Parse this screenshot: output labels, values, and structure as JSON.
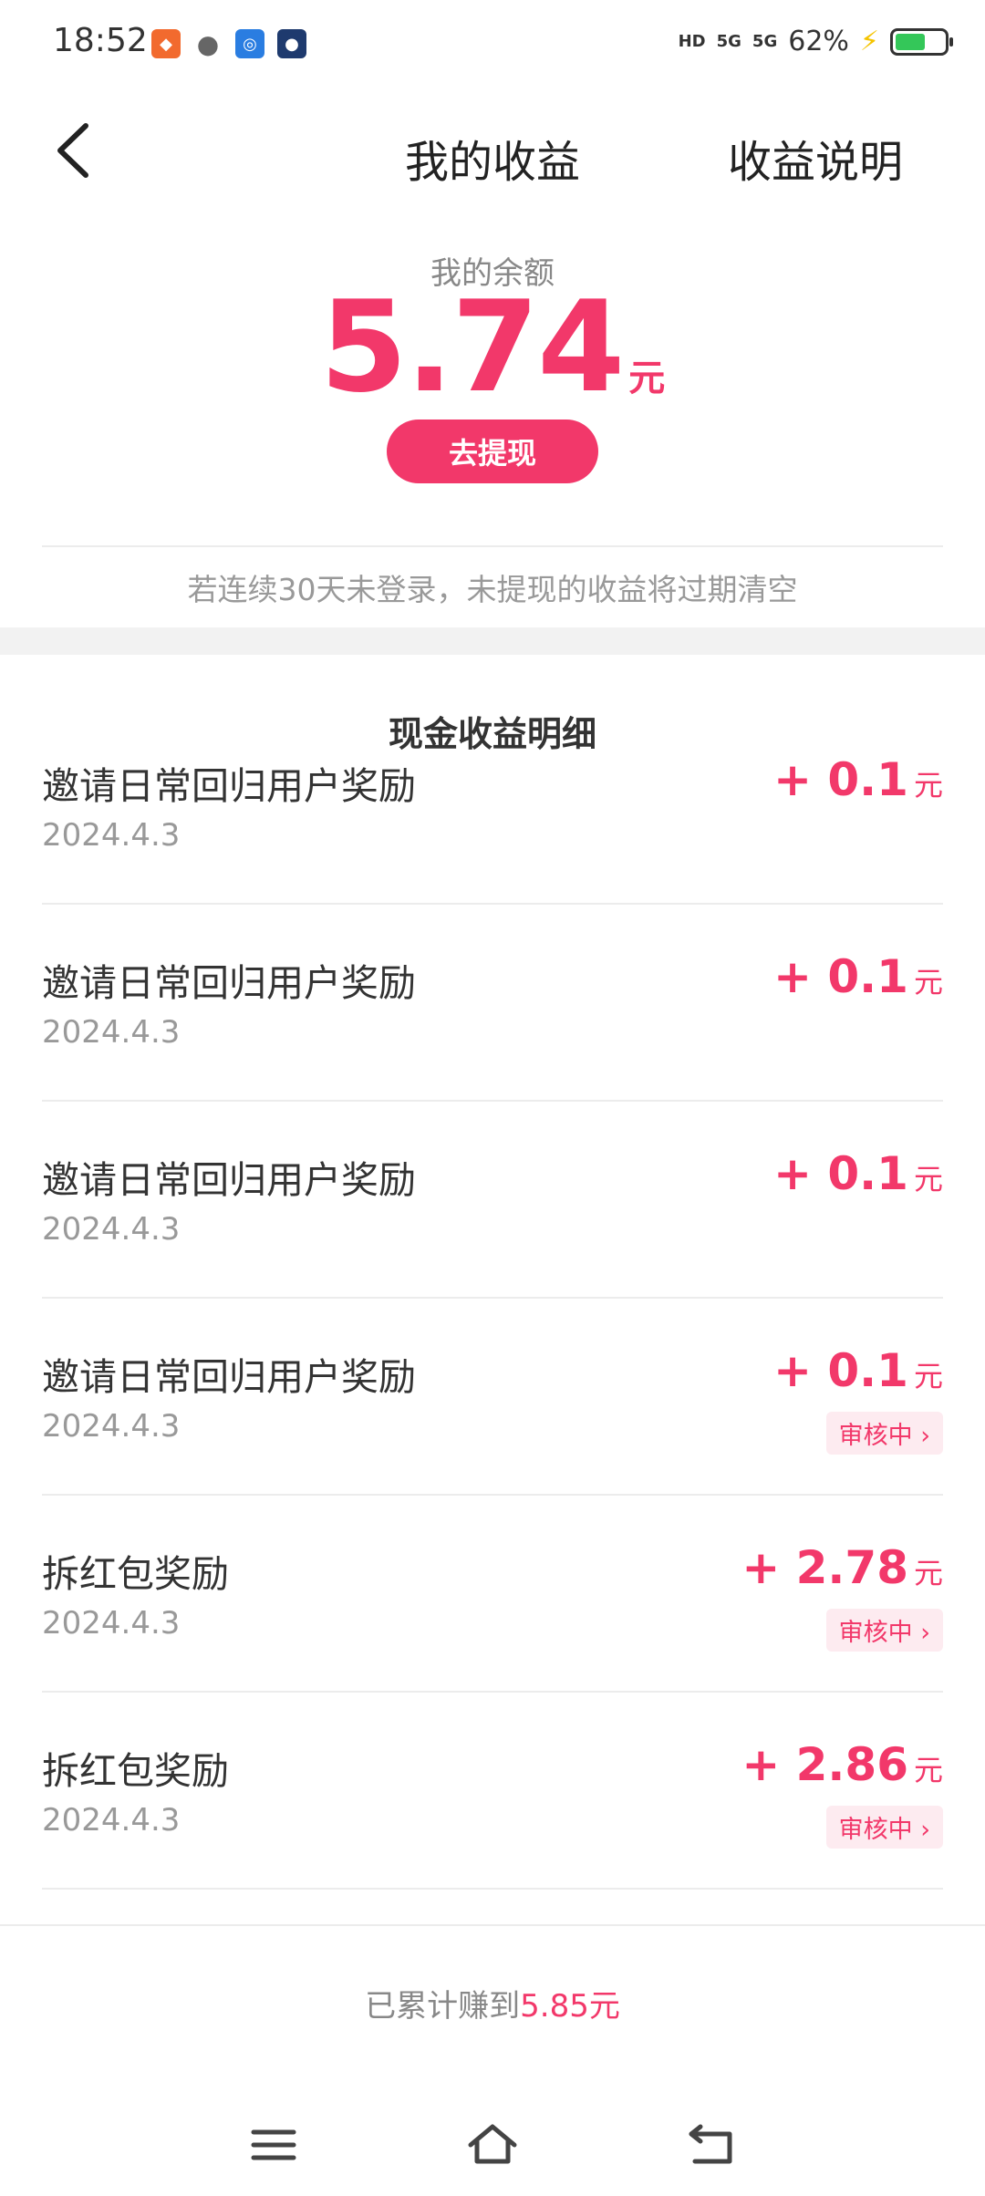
{
  "status_bar": {
    "time": "18:52",
    "signal_1": "HD",
    "signal_2": "5G",
    "signal_3": "5G",
    "battery_text": "62%",
    "battery_level": 0.62
  },
  "nav": {
    "title": "我的收益",
    "right_label": "收益说明"
  },
  "balance": {
    "label": "我的余额",
    "amount": "5.74",
    "unit": "元",
    "withdraw_label": "去提现",
    "notice": "若连续30天未登录，未提现的收益将过期清空"
  },
  "details": {
    "title": "现金收益明细",
    "items": [
      {
        "title": "邀请日常回归用户奖励",
        "date": "2024.4.3",
        "amount": "+ 0.1",
        "unit": "元",
        "status": ""
      },
      {
        "title": "邀请日常回归用户奖励",
        "date": "2024.4.3",
        "amount": "+ 0.1",
        "unit": "元",
        "status": ""
      },
      {
        "title": "邀请日常回归用户奖励",
        "date": "2024.4.3",
        "amount": "+ 0.1",
        "unit": "元",
        "status": ""
      },
      {
        "title": "邀请日常回归用户奖励",
        "date": "2024.4.3",
        "amount": "+ 0.1",
        "unit": "元",
        "status": "审核中 ›"
      },
      {
        "title": "拆红包奖励",
        "date": "2024.4.3",
        "amount": "+ 2.78",
        "unit": "元",
        "status": "审核中 ›"
      },
      {
        "title": "拆红包奖励",
        "date": "2024.4.3",
        "amount": "+ 2.86",
        "unit": "元",
        "status": "审核中 ›"
      }
    ]
  },
  "footer": {
    "total_prefix": "已累计赚到",
    "total_value": "5.85元"
  },
  "colors": {
    "accent": "#f2386a",
    "battery": "#34c759"
  }
}
